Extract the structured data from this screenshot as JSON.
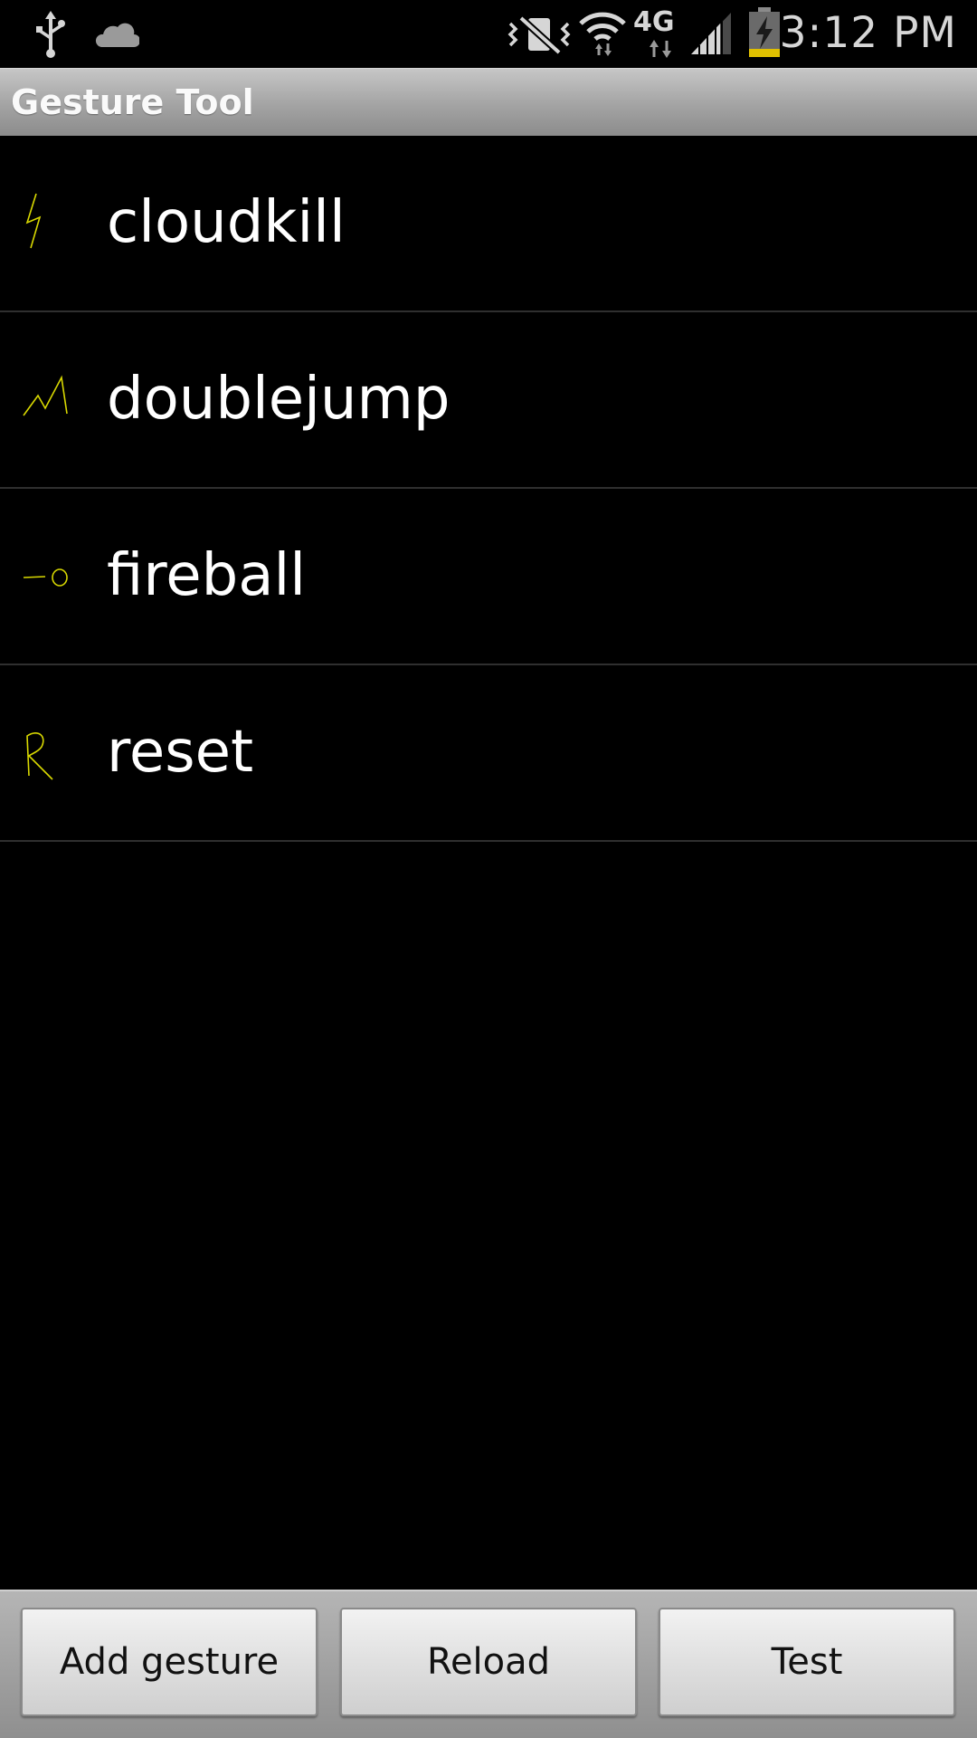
{
  "status_bar": {
    "time": "3:12 PM",
    "network_label": "4G",
    "icons": [
      "usb-icon",
      "cloud-icon",
      "vibrate-mute-icon",
      "wifi-icon",
      "4g-lte-icon",
      "signal-icon",
      "battery-charging-icon"
    ]
  },
  "app": {
    "title": "Gesture Tool"
  },
  "gestures": [
    {
      "name": "cloudkill",
      "thumb": "lightning-gesture-icon"
    },
    {
      "name": "doublejump",
      "thumb": "zigzag-gesture-icon"
    },
    {
      "name": "fireball",
      "thumb": "dash-circle-gesture-icon"
    },
    {
      "name": "reset",
      "thumb": "r-letter-gesture-icon"
    }
  ],
  "buttons": {
    "add": "Add gesture",
    "reload": "Reload",
    "test": "Test"
  },
  "colors": {
    "gesture_stroke": "#d8d800",
    "background": "#000000",
    "status_text": "#d6d6d6",
    "battery_charge": "#e0c000"
  }
}
